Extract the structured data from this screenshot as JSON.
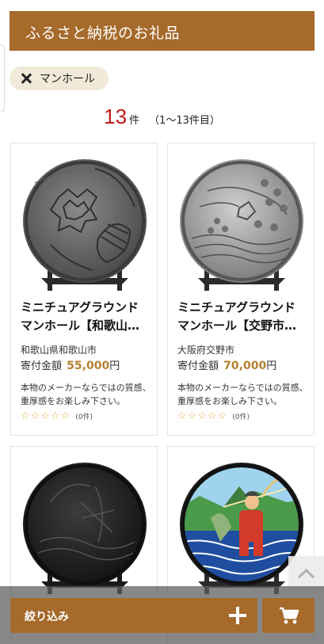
{
  "header": {
    "title": "ふるさと納税のお礼品"
  },
  "filter_chip": {
    "label": "マンホール"
  },
  "results": {
    "count": "13",
    "unit": "件",
    "range": "（1〜13件目）"
  },
  "products": [
    {
      "title_line1": "ミニチュアグラウンド",
      "title_line2": "マンホール【和歌山…",
      "region": "和歌山県和歌山市",
      "amount_label": "寄付金額",
      "amount": "55,000",
      "yen": "円",
      "description": "本物のメーカーならではの質感、重厚感をお楽しみ下さい。",
      "review_count": "(0件)",
      "rating": 0
    },
    {
      "title_line1": "ミニチュアグラウンド",
      "title_line2": "マンホール【交野市…",
      "region": "大阪府交野市",
      "amount_label": "寄付金額",
      "amount": "70,000",
      "yen": "円",
      "description": "本物のメーカーならではの質感、重厚感をお楽しみ下さい。",
      "review_count": "(0件)",
      "rating": 0
    }
  ],
  "bottom_bar": {
    "filter_label": "絞り込み"
  },
  "colors": {
    "brand": "#a66a2b",
    "count": "#c21a1a",
    "amount": "#b5802f",
    "star": "#e1b24a"
  }
}
